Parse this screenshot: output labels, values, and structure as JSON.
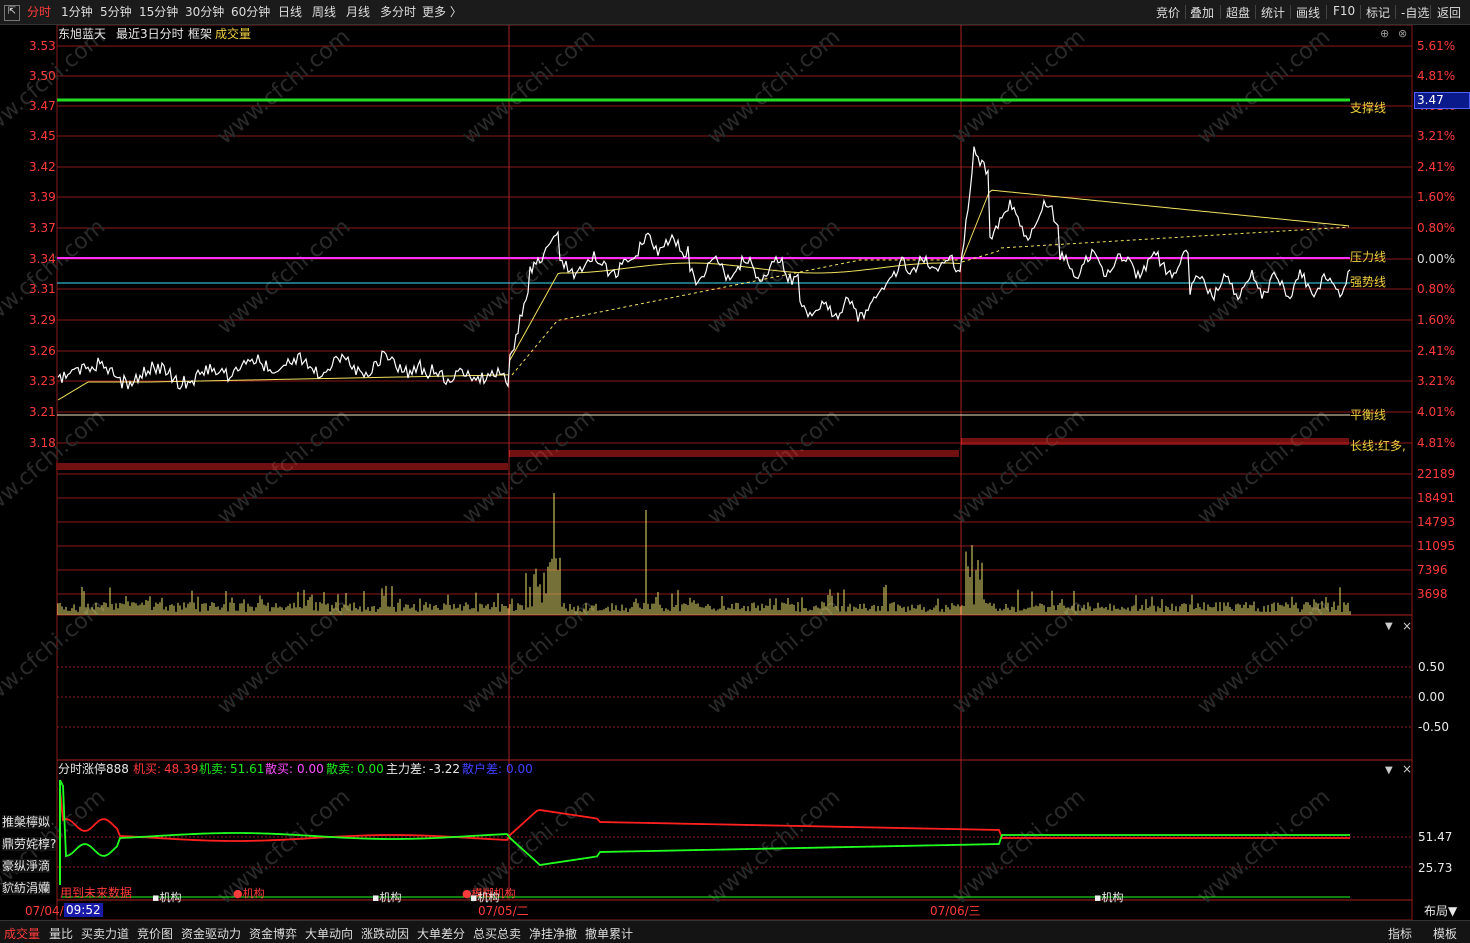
{
  "topbar": {
    "back_icon": "back-icon",
    "tabs": [
      "分时",
      "1分钟",
      "5分钟",
      "15分钟",
      "30分钟",
      "60分钟",
      "日线",
      "周线",
      "月线",
      "多分时",
      "更多 〉"
    ],
    "active_tab": "分时",
    "right_buttons": [
      "竞价",
      "叠加",
      "超盘",
      "统计",
      "画线",
      "F10",
      "标记",
      "-自选",
      "返回"
    ]
  },
  "chart_header": {
    "stock_name": "东旭蓝天",
    "period": "最近3日分时",
    "frame": "框架",
    "indicator": "成交量"
  },
  "price_axis": [
    "3.53",
    "3.50",
    "3.47",
    "3.45",
    "3.42",
    "3.39",
    "3.37",
    "3.34",
    "3.31",
    "3.29",
    "3.26",
    "3.23",
    "3.21",
    "3.18"
  ],
  "pct_axis": [
    "5.61%",
    "4.81%",
    "4.01%",
    "3.21%",
    "2.41%",
    "1.60%",
    "0.80%",
    "0.00%",
    "0.80%",
    "1.60%",
    "2.41%",
    "3.21%",
    "4.01%",
    "4.81%"
  ],
  "current_price_tag": "3.47",
  "line_labels": {
    "support": "支撑线",
    "pressure": "压力线",
    "strong": "强势线",
    "balance": "平衡线",
    "long": "长线:红多,"
  },
  "volume_axis": [
    "22189",
    "18491",
    "14793",
    "11095",
    "7396",
    "3698"
  ],
  "indicator2_axis": [
    "0.50",
    "0.00",
    "-0.50"
  ],
  "indicator3": {
    "name": "分时涨停888",
    "jimai_label": "机买:",
    "jimai": "48.39",
    "jimai2_label": "机卖:",
    "jimai2": "51.61",
    "sanmai_label": "散买:",
    "sanmai": "0.00",
    "sanmai2_label": "散卖:",
    "sanmai2": "0.00",
    "zhulicha_label": "主力差:",
    "zhulicha": "-3.22",
    "sanhucha_label": "散户差:",
    "sanhucha": "0.00",
    "axis": [
      "51.47",
      "25.73"
    ]
  },
  "left_garbled": [
    "推槃檸姒",
    "鼎劳姹椁?",
    "豪纵淨滴",
    "貁紡涓孏"
  ],
  "no_data_text": "用到未来数据",
  "markers": [
    "机构",
    "机构",
    "机构",
    "模糊机构",
    "机构",
    "机构"
  ],
  "time_axis": {
    "day1": "07/04/",
    "cursor": "09:52",
    "day2": "07/05/二",
    "day3": "07/06/三",
    "layout": "布局▼"
  },
  "bottom_tabs": [
    "成交量",
    "量比",
    "买卖力道",
    "竞价图",
    "资金驱动力",
    "资金博弈",
    "大单动向",
    "涨跌动因",
    "大单差分",
    "总买总卖",
    "净挂净撤",
    "撤单累计"
  ],
  "active_bottom_tab": "成交量",
  "bottom_right": [
    "指标",
    "模板"
  ],
  "watermark": "www.cfchi.com",
  "colors": {
    "price_line": "#ffffff",
    "avg_line": "#f0e060",
    "support_line": "#22dd22",
    "pressure_line": "#ff30ff",
    "strong_line": "#40e0ff",
    "grid": "#8b1a1a",
    "buy_line": "#ff2020",
    "sell_line": "#20ff20"
  }
}
